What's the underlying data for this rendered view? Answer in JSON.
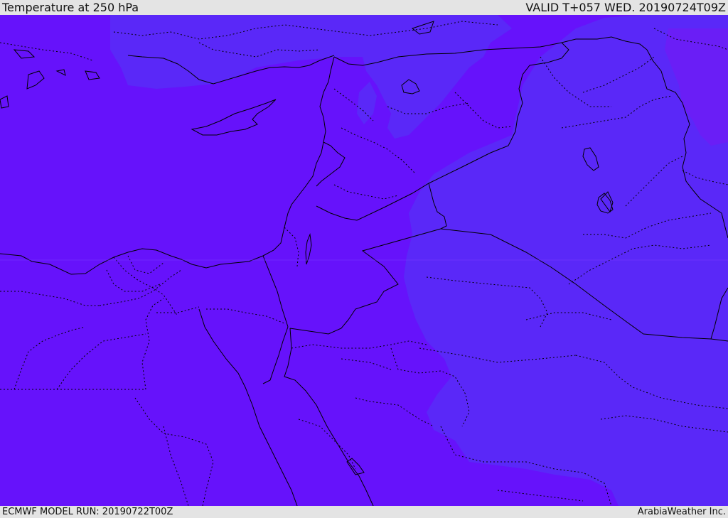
{
  "header": {
    "title": "Temperature at 250 hPa",
    "valid_time": "VALID T+057 WED. 20190724T09Z"
  },
  "footer": {
    "model_run": "ECMWF MODEL RUN: 20190722T00Z",
    "credit": "ArabiaWeather Inc."
  },
  "map": {
    "region": "Eastern Mediterranean / Levant / Northern Arabia",
    "colors": {
      "main_field": "#6612fb",
      "light_field": "#5a28f8",
      "background": "#e4e4e4",
      "borders": "#000000"
    }
  }
}
